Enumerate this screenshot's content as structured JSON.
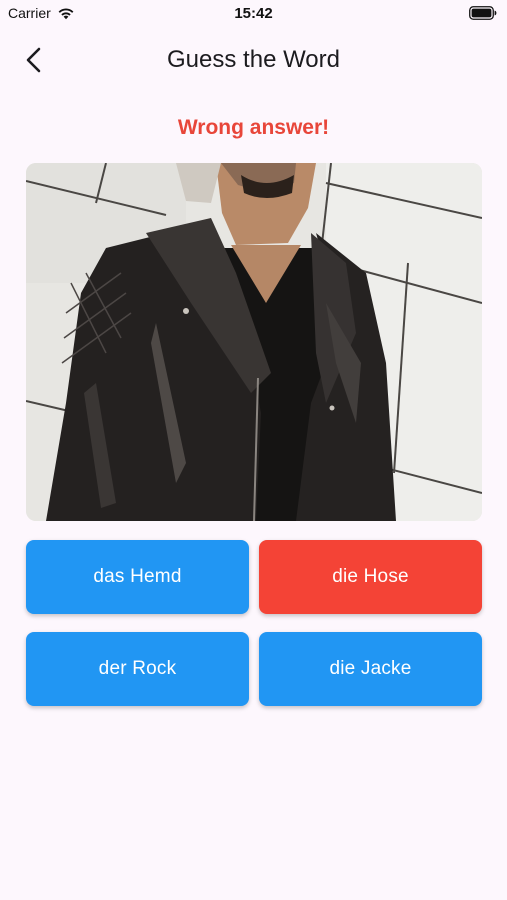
{
  "status_bar": {
    "carrier": "Carrier",
    "time": "15:42",
    "icons": [
      "wifi-icon",
      "battery-icon"
    ]
  },
  "app_bar": {
    "title": "Guess the Word",
    "back_icon": "chevron-left-icon"
  },
  "feedback": {
    "text": "Wrong answer!",
    "color": "#E8463A"
  },
  "answers": [
    {
      "label": "das Hemd",
      "state": "default",
      "color": "#2196F3"
    },
    {
      "label": "die Hose",
      "state": "wrong",
      "color": "#F44336"
    },
    {
      "label": "der Rock",
      "state": "default",
      "color": "#2196F3"
    },
    {
      "label": "die Jacke",
      "state": "default",
      "color": "#2196F3"
    }
  ],
  "colors": {
    "background": "#FDF7FD",
    "primary": "#2196F3",
    "error": "#F44336"
  }
}
